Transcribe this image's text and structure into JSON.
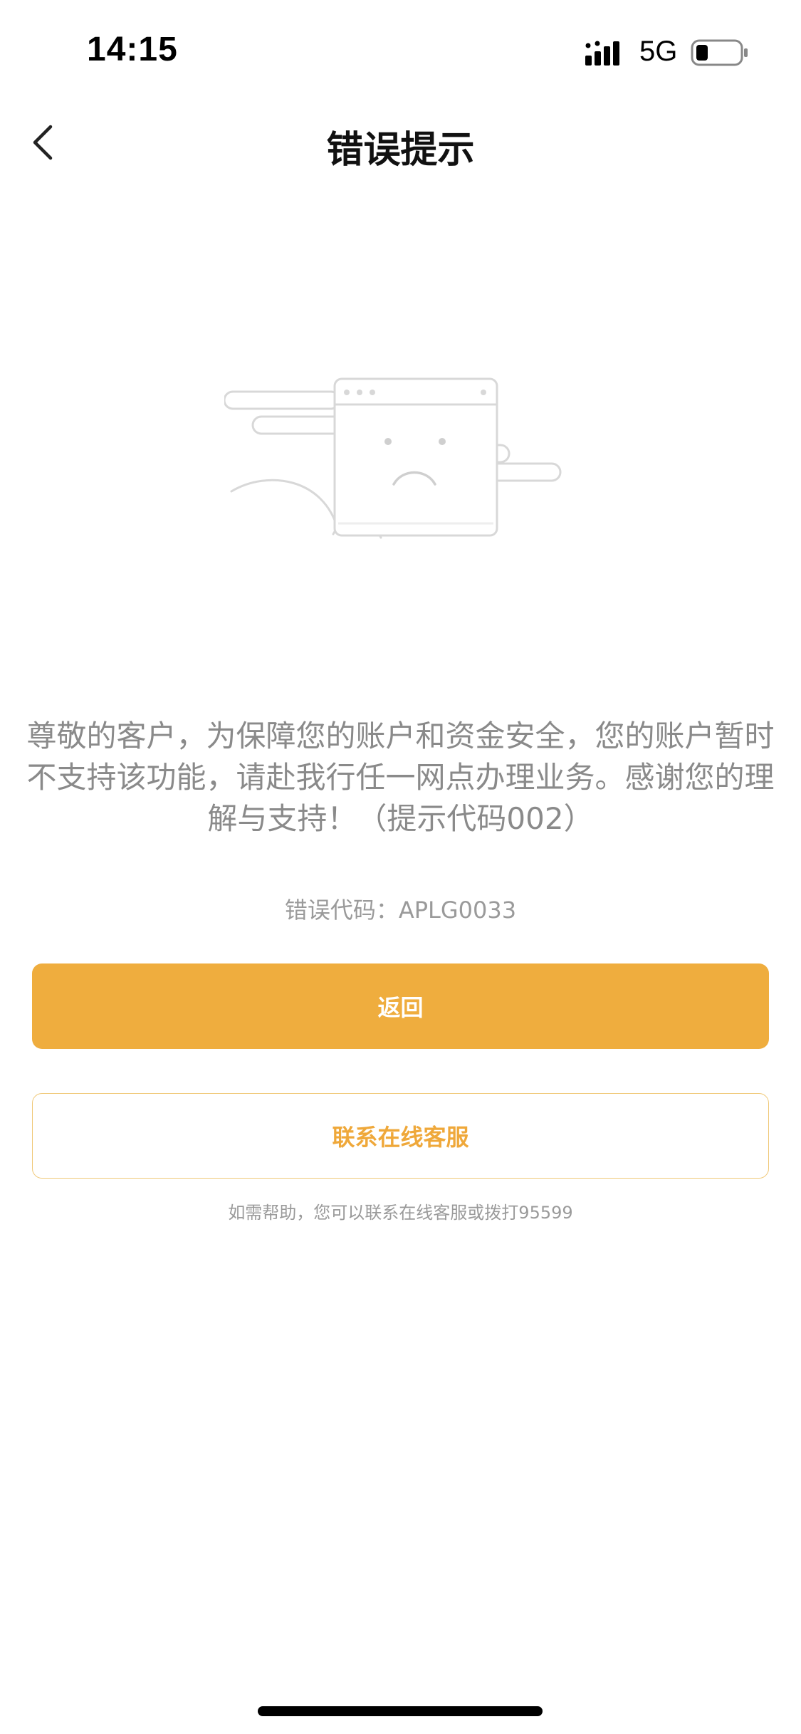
{
  "status_bar": {
    "time": "14:15",
    "network": "5G",
    "icons": [
      "signal-icon",
      "battery-icon"
    ]
  },
  "nav": {
    "title": "错误提示",
    "back_icon": "chevron-left-icon"
  },
  "illustration": {
    "icon": "sad-browser-window-illustration"
  },
  "message": {
    "text": "尊敬的客户，为保障您的账户和资金安全，您的账户暂时不支持该功能，请赴我行任一网点办理业务。感谢您的理解与支持！（提示代码002）"
  },
  "error": {
    "code_text": "错误代码：APLG0033"
  },
  "buttons": {
    "back_label": "返回",
    "contact_label": "联系在线客服"
  },
  "help": {
    "text": "如需帮助，您可以联系在线客服或拨打95599"
  },
  "colors": {
    "primary": "#efad3e",
    "secondary_text": "#efa83a",
    "secondary_border": "#f0c877",
    "muted_text": "#8a8a8a"
  }
}
